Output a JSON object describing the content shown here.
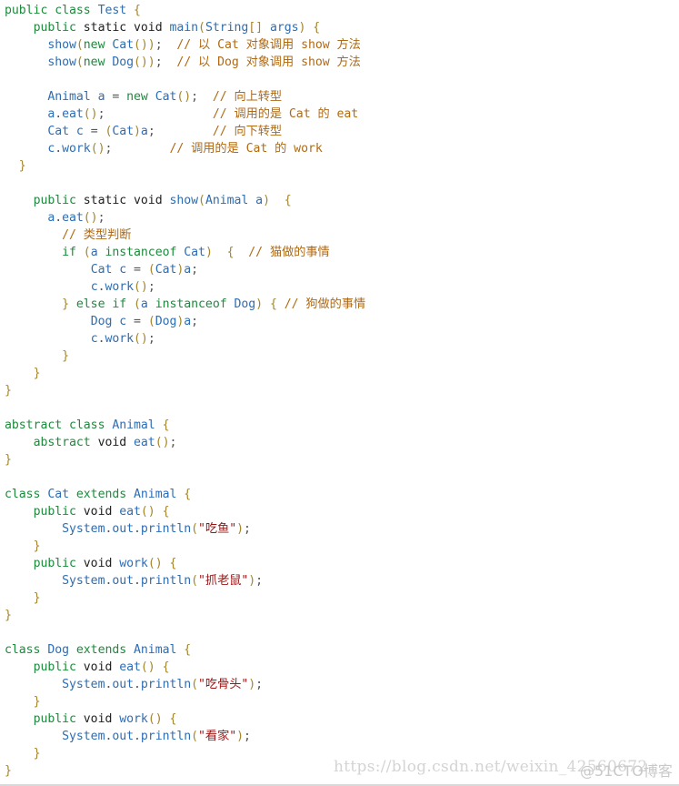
{
  "code": {
    "language": "java",
    "lines": [
      {
        "indent": 0,
        "tokens": [
          [
            "kw",
            "public"
          ],
          [
            "sp",
            " "
          ],
          [
            "kw",
            "class"
          ],
          [
            "sp",
            " "
          ],
          [
            "id",
            "Test"
          ],
          [
            "sp",
            " "
          ],
          [
            "pn",
            "{"
          ]
        ]
      },
      {
        "indent": 4,
        "tokens": [
          [
            "kw",
            "public"
          ],
          [
            "sp",
            " "
          ],
          [
            "kd",
            "static"
          ],
          [
            "sp",
            " "
          ],
          [
            "kd",
            "void"
          ],
          [
            "sp",
            " "
          ],
          [
            "id",
            "main"
          ],
          [
            "pn",
            "("
          ],
          [
            "id",
            "String"
          ],
          [
            "pn",
            "[]"
          ],
          [
            "sp",
            " "
          ],
          [
            "id",
            "args"
          ],
          [
            "pn",
            ")"
          ],
          [
            "sp",
            " "
          ],
          [
            "pn",
            "{"
          ]
        ]
      },
      {
        "indent": 6,
        "tokens": [
          [
            "id",
            "show"
          ],
          [
            "pn",
            "("
          ],
          [
            "kw",
            "new"
          ],
          [
            "sp",
            " "
          ],
          [
            "id",
            "Cat"
          ],
          [
            "pn",
            "())"
          ],
          [
            "op",
            ";"
          ],
          [
            "sp",
            "  "
          ],
          [
            "cm",
            "// 以 Cat 对象调用 show 方法"
          ]
        ]
      },
      {
        "indent": 6,
        "tokens": [
          [
            "id",
            "show"
          ],
          [
            "pn",
            "("
          ],
          [
            "kw",
            "new"
          ],
          [
            "sp",
            " "
          ],
          [
            "id",
            "Dog"
          ],
          [
            "pn",
            "())"
          ],
          [
            "op",
            ";"
          ],
          [
            "sp",
            "  "
          ],
          [
            "cm",
            "// 以 Dog 对象调用 show 方法"
          ]
        ]
      },
      {
        "indent": 0,
        "tokens": []
      },
      {
        "indent": 6,
        "tokens": [
          [
            "id",
            "Animal"
          ],
          [
            "sp",
            " "
          ],
          [
            "id",
            "a"
          ],
          [
            "sp",
            " "
          ],
          [
            "op",
            "="
          ],
          [
            "sp",
            " "
          ],
          [
            "kw",
            "new"
          ],
          [
            "sp",
            " "
          ],
          [
            "id",
            "Cat"
          ],
          [
            "pn",
            "()"
          ],
          [
            "op",
            ";"
          ],
          [
            "sp",
            "  "
          ],
          [
            "cm",
            "// 向上转型"
          ]
        ]
      },
      {
        "indent": 6,
        "tokens": [
          [
            "id",
            "a"
          ],
          [
            "op",
            "."
          ],
          [
            "id",
            "eat"
          ],
          [
            "pn",
            "()"
          ],
          [
            "op",
            ";"
          ],
          [
            "sp",
            "               "
          ],
          [
            "cm",
            "// 调用的是 Cat 的 eat"
          ]
        ]
      },
      {
        "indent": 6,
        "tokens": [
          [
            "id",
            "Cat"
          ],
          [
            "sp",
            " "
          ],
          [
            "id",
            "c"
          ],
          [
            "sp",
            " "
          ],
          [
            "op",
            "="
          ],
          [
            "sp",
            " "
          ],
          [
            "pn",
            "("
          ],
          [
            "id",
            "Cat"
          ],
          [
            "pn",
            ")"
          ],
          [
            "id",
            "a"
          ],
          [
            "op",
            ";"
          ],
          [
            "sp",
            "        "
          ],
          [
            "cm",
            "// 向下转型"
          ]
        ]
      },
      {
        "indent": 6,
        "tokens": [
          [
            "id",
            "c"
          ],
          [
            "op",
            "."
          ],
          [
            "id",
            "work"
          ],
          [
            "pn",
            "()"
          ],
          [
            "op",
            ";"
          ],
          [
            "sp",
            "        "
          ],
          [
            "cm",
            "// 调用的是 Cat 的 work"
          ]
        ]
      },
      {
        "indent": 2,
        "tokens": [
          [
            "pn",
            "}"
          ]
        ]
      },
      {
        "indent": 0,
        "tokens": []
      },
      {
        "indent": 4,
        "tokens": [
          [
            "kw",
            "public"
          ],
          [
            "sp",
            " "
          ],
          [
            "kd",
            "static"
          ],
          [
            "sp",
            " "
          ],
          [
            "kd",
            "void"
          ],
          [
            "sp",
            " "
          ],
          [
            "id",
            "show"
          ],
          [
            "pn",
            "("
          ],
          [
            "id",
            "Animal"
          ],
          [
            "sp",
            " "
          ],
          [
            "id",
            "a"
          ],
          [
            "pn",
            ")"
          ],
          [
            "sp",
            "  "
          ],
          [
            "pn",
            "{"
          ]
        ]
      },
      {
        "indent": 6,
        "tokens": [
          [
            "id",
            "a"
          ],
          [
            "op",
            "."
          ],
          [
            "id",
            "eat"
          ],
          [
            "pn",
            "()"
          ],
          [
            "op",
            ";"
          ]
        ]
      },
      {
        "indent": 8,
        "tokens": [
          [
            "cm",
            "// 类型判断"
          ]
        ]
      },
      {
        "indent": 8,
        "tokens": [
          [
            "kw",
            "if"
          ],
          [
            "sp",
            " "
          ],
          [
            "pn",
            "("
          ],
          [
            "id",
            "a"
          ],
          [
            "sp",
            " "
          ],
          [
            "kw",
            "instanceof"
          ],
          [
            "sp",
            " "
          ],
          [
            "id",
            "Cat"
          ],
          [
            "pn",
            ")"
          ],
          [
            "sp",
            "  "
          ],
          [
            "pn",
            "{"
          ],
          [
            "sp",
            "  "
          ],
          [
            "cm",
            "// 猫做的事情"
          ]
        ]
      },
      {
        "indent": 12,
        "tokens": [
          [
            "id",
            "Cat"
          ],
          [
            "sp",
            " "
          ],
          [
            "id",
            "c"
          ],
          [
            "sp",
            " "
          ],
          [
            "op",
            "="
          ],
          [
            "sp",
            " "
          ],
          [
            "pn",
            "("
          ],
          [
            "id",
            "Cat"
          ],
          [
            "pn",
            ")"
          ],
          [
            "id",
            "a"
          ],
          [
            "op",
            ";"
          ]
        ]
      },
      {
        "indent": 12,
        "tokens": [
          [
            "id",
            "c"
          ],
          [
            "op",
            "."
          ],
          [
            "id",
            "work"
          ],
          [
            "pn",
            "()"
          ],
          [
            "op",
            ";"
          ]
        ]
      },
      {
        "indent": 8,
        "tokens": [
          [
            "pn",
            "}"
          ],
          [
            "sp",
            " "
          ],
          [
            "kw",
            "else"
          ],
          [
            "sp",
            " "
          ],
          [
            "kw",
            "if"
          ],
          [
            "sp",
            " "
          ],
          [
            "pn",
            "("
          ],
          [
            "id",
            "a"
          ],
          [
            "sp",
            " "
          ],
          [
            "kw",
            "instanceof"
          ],
          [
            "sp",
            " "
          ],
          [
            "id",
            "Dog"
          ],
          [
            "pn",
            ")"
          ],
          [
            "sp",
            " "
          ],
          [
            "pn",
            "{"
          ],
          [
            "sp",
            " "
          ],
          [
            "cm",
            "// 狗做的事情"
          ]
        ]
      },
      {
        "indent": 12,
        "tokens": [
          [
            "id",
            "Dog"
          ],
          [
            "sp",
            " "
          ],
          [
            "id",
            "c"
          ],
          [
            "sp",
            " "
          ],
          [
            "op",
            "="
          ],
          [
            "sp",
            " "
          ],
          [
            "pn",
            "("
          ],
          [
            "id",
            "Dog"
          ],
          [
            "pn",
            ")"
          ],
          [
            "id",
            "a"
          ],
          [
            "op",
            ";"
          ]
        ]
      },
      {
        "indent": 12,
        "tokens": [
          [
            "id",
            "c"
          ],
          [
            "op",
            "."
          ],
          [
            "id",
            "work"
          ],
          [
            "pn",
            "()"
          ],
          [
            "op",
            ";"
          ]
        ]
      },
      {
        "indent": 8,
        "tokens": [
          [
            "pn",
            "}"
          ]
        ]
      },
      {
        "indent": 4,
        "tokens": [
          [
            "pn",
            "}"
          ]
        ]
      },
      {
        "indent": 0,
        "tokens": [
          [
            "pn",
            "}"
          ]
        ]
      },
      {
        "indent": 0,
        "tokens": []
      },
      {
        "indent": 0,
        "tokens": [
          [
            "kw",
            "abstract"
          ],
          [
            "sp",
            " "
          ],
          [
            "kw",
            "class"
          ],
          [
            "sp",
            " "
          ],
          [
            "id",
            "Animal"
          ],
          [
            "sp",
            " "
          ],
          [
            "pn",
            "{"
          ]
        ]
      },
      {
        "indent": 4,
        "tokens": [
          [
            "kw",
            "abstract"
          ],
          [
            "sp",
            " "
          ],
          [
            "kd",
            "void"
          ],
          [
            "sp",
            " "
          ],
          [
            "id",
            "eat"
          ],
          [
            "pn",
            "()"
          ],
          [
            "op",
            ";"
          ]
        ]
      },
      {
        "indent": 0,
        "tokens": [
          [
            "pn",
            "}"
          ]
        ]
      },
      {
        "indent": 0,
        "tokens": []
      },
      {
        "indent": 0,
        "tokens": [
          [
            "kw",
            "class"
          ],
          [
            "sp",
            " "
          ],
          [
            "id",
            "Cat"
          ],
          [
            "sp",
            " "
          ],
          [
            "kw",
            "extends"
          ],
          [
            "sp",
            " "
          ],
          [
            "id",
            "Animal"
          ],
          [
            "sp",
            " "
          ],
          [
            "pn",
            "{"
          ]
        ]
      },
      {
        "indent": 4,
        "tokens": [
          [
            "kw",
            "public"
          ],
          [
            "sp",
            " "
          ],
          [
            "kd",
            "void"
          ],
          [
            "sp",
            " "
          ],
          [
            "id",
            "eat"
          ],
          [
            "pn",
            "()"
          ],
          [
            "sp",
            " "
          ],
          [
            "pn",
            "{"
          ]
        ]
      },
      {
        "indent": 8,
        "tokens": [
          [
            "id",
            "System"
          ],
          [
            "op",
            "."
          ],
          [
            "id",
            "out"
          ],
          [
            "op",
            "."
          ],
          [
            "id",
            "println"
          ],
          [
            "pn",
            "("
          ],
          [
            "st",
            "\"吃鱼\""
          ],
          [
            "pn",
            ")"
          ],
          [
            "op",
            ";"
          ]
        ]
      },
      {
        "indent": 4,
        "tokens": [
          [
            "pn",
            "}"
          ]
        ]
      },
      {
        "indent": 4,
        "tokens": [
          [
            "kw",
            "public"
          ],
          [
            "sp",
            " "
          ],
          [
            "kd",
            "void"
          ],
          [
            "sp",
            " "
          ],
          [
            "id",
            "work"
          ],
          [
            "pn",
            "()"
          ],
          [
            "sp",
            " "
          ],
          [
            "pn",
            "{"
          ]
        ]
      },
      {
        "indent": 8,
        "tokens": [
          [
            "id",
            "System"
          ],
          [
            "op",
            "."
          ],
          [
            "id",
            "out"
          ],
          [
            "op",
            "."
          ],
          [
            "id",
            "println"
          ],
          [
            "pn",
            "("
          ],
          [
            "st",
            "\"抓老鼠\""
          ],
          [
            "pn",
            ")"
          ],
          [
            "op",
            ";"
          ]
        ]
      },
      {
        "indent": 4,
        "tokens": [
          [
            "pn",
            "}"
          ]
        ]
      },
      {
        "indent": 0,
        "tokens": [
          [
            "pn",
            "}"
          ]
        ]
      },
      {
        "indent": 0,
        "tokens": []
      },
      {
        "indent": 0,
        "tokens": [
          [
            "kw",
            "class"
          ],
          [
            "sp",
            " "
          ],
          [
            "id",
            "Dog"
          ],
          [
            "sp",
            " "
          ],
          [
            "kw",
            "extends"
          ],
          [
            "sp",
            " "
          ],
          [
            "id",
            "Animal"
          ],
          [
            "sp",
            " "
          ],
          [
            "pn",
            "{"
          ]
        ]
      },
      {
        "indent": 4,
        "tokens": [
          [
            "kw",
            "public"
          ],
          [
            "sp",
            " "
          ],
          [
            "kd",
            "void"
          ],
          [
            "sp",
            " "
          ],
          [
            "id",
            "eat"
          ],
          [
            "pn",
            "()"
          ],
          [
            "sp",
            " "
          ],
          [
            "pn",
            "{"
          ]
        ]
      },
      {
        "indent": 8,
        "tokens": [
          [
            "id",
            "System"
          ],
          [
            "op",
            "."
          ],
          [
            "id",
            "out"
          ],
          [
            "op",
            "."
          ],
          [
            "id",
            "println"
          ],
          [
            "pn",
            "("
          ],
          [
            "st",
            "\"吃骨头\""
          ],
          [
            "pn",
            ")"
          ],
          [
            "op",
            ";"
          ]
        ]
      },
      {
        "indent": 4,
        "tokens": [
          [
            "pn",
            "}"
          ]
        ]
      },
      {
        "indent": 4,
        "tokens": [
          [
            "kw",
            "public"
          ],
          [
            "sp",
            " "
          ],
          [
            "kd",
            "void"
          ],
          [
            "sp",
            " "
          ],
          [
            "id",
            "work"
          ],
          [
            "pn",
            "()"
          ],
          [
            "sp",
            " "
          ],
          [
            "pn",
            "{"
          ]
        ]
      },
      {
        "indent": 8,
        "tokens": [
          [
            "id",
            "System"
          ],
          [
            "op",
            "."
          ],
          [
            "id",
            "out"
          ],
          [
            "op",
            "."
          ],
          [
            "id",
            "println"
          ],
          [
            "pn",
            "("
          ],
          [
            "st",
            "\"看家\""
          ],
          [
            "pn",
            ")"
          ],
          [
            "op",
            ";"
          ]
        ]
      },
      {
        "indent": 4,
        "tokens": [
          [
            "pn",
            "}"
          ]
        ]
      },
      {
        "indent": 0,
        "tokens": [
          [
            "pn",
            "}"
          ]
        ]
      }
    ]
  },
  "watermark": {
    "url_text": "https://blog.csdn.net/weixin_42560672",
    "brand_text": "@51CTO博客"
  },
  "colors": {
    "keyword": "#1d8a3c",
    "type_keyword": "#1f1f1f",
    "identifier": "#2d6db4",
    "punctuation": "#a3862c",
    "comment": "#b06a14",
    "string": "#9b1515"
  }
}
